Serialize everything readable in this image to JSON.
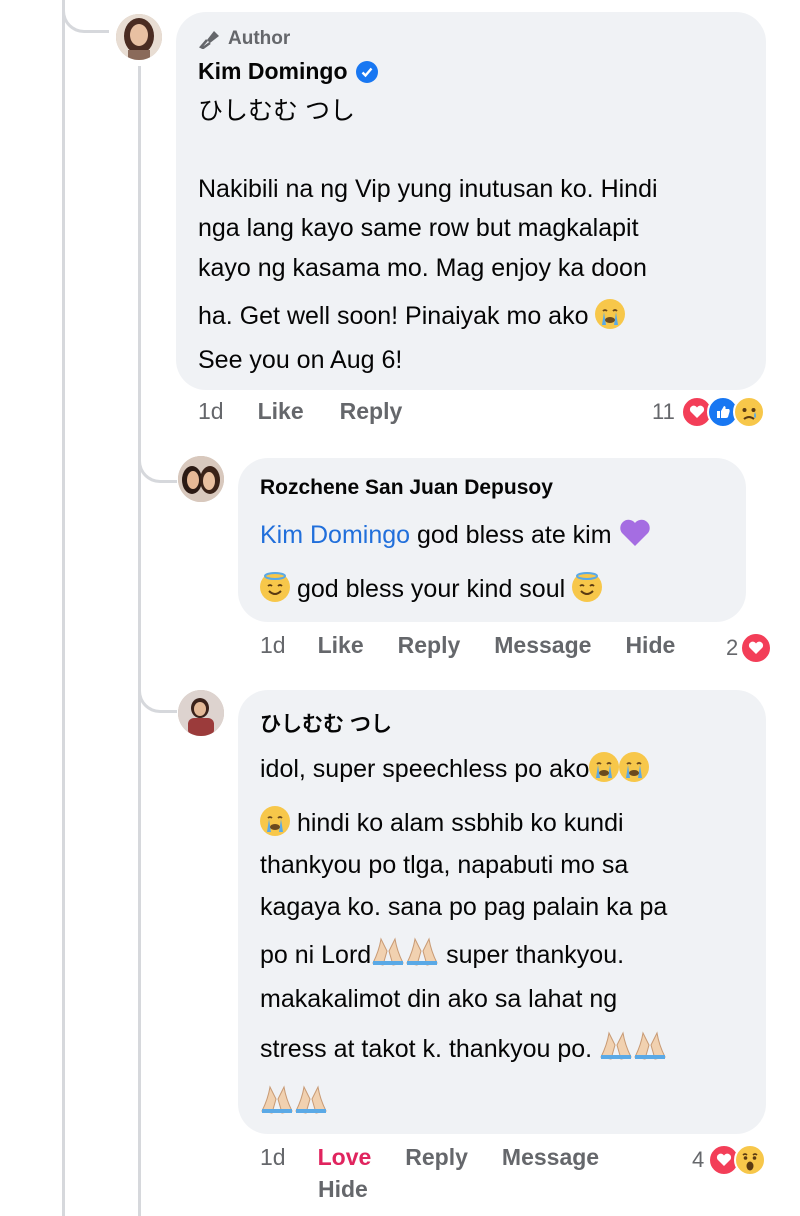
{
  "main_comment": {
    "author_badge": "Author",
    "author_name": "Kim Domingo",
    "tagged_name": "ひしむむ つし",
    "text_lines": [
      "Nakibili na ng Vip yung inutusan ko. Hindi",
      "nga lang kayo same row but magkalapit",
      "kayo ng kasama mo. Mag enjoy ka doon",
      "ha. Get well soon! Pinaiyak mo ako",
      "See you on Aug 6!"
    ],
    "time": "1d",
    "like_label": "Like",
    "reply_label": "Reply",
    "reaction_count": "11",
    "reactions": [
      "love-icon",
      "like-icon",
      "sad-icon"
    ]
  },
  "reply_1": {
    "author_name": "Rozchene San Juan Depusoy",
    "mention": "Kim Domingo",
    "line1_text": " god bless ate kim",
    "line2_text": " god bless your kind soul ",
    "time": "1d",
    "like_label": "Like",
    "reply_label": "Reply",
    "message_label": "Message",
    "hide_label": "Hide",
    "reaction_count": "2",
    "reactions": [
      "love-icon"
    ]
  },
  "reply_2": {
    "author_name": "ひしむむ つし",
    "text_lines": [
      "idol, super speechless po ako",
      " hindi ko alam ssbhib ko kundi",
      "thankyou po tlga, napabuti mo sa",
      "kagaya ko. sana po pag palain ka pa",
      "po ni Lord",
      " super thankyou.",
      "makakalimot din ako sa lahat ng",
      "stress at takot k. thankyou po. "
    ],
    "time": "1d",
    "love_label": "Love",
    "reply_label": "Reply",
    "message_label": "Message",
    "hide_label": "Hide",
    "reaction_count": "4",
    "reactions": [
      "love-icon",
      "wow-icon"
    ]
  },
  "colors": {
    "bubble": "#f0f2f5",
    "link": "#216fdb",
    "love": "#f33e58",
    "like": "#1877f2",
    "muted": "#65676b"
  }
}
